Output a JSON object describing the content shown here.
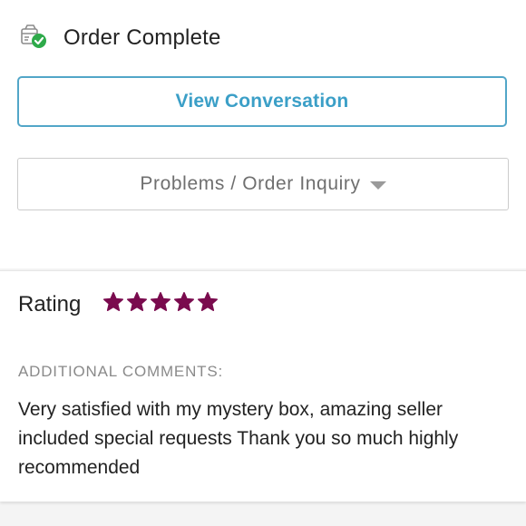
{
  "order": {
    "status_icon": "package-check-icon",
    "status_title": "Order Complete"
  },
  "actions": {
    "view_conversation_label": "View Conversation",
    "problems_label": "Problems / Order Inquiry",
    "problems_icon": "chevron-down-icon"
  },
  "rating": {
    "label": "Rating",
    "stars": 5,
    "max_stars": 5,
    "star_color": "#7a0b4e"
  },
  "comments": {
    "label": "ADDITIONAL COMMENTS:",
    "text": "Very satisfied with my mystery box, amazing seller included special requests Thank you so much highly recommended"
  },
  "colors": {
    "accent": "#3b9fc7",
    "success": "#2eaa4a"
  }
}
